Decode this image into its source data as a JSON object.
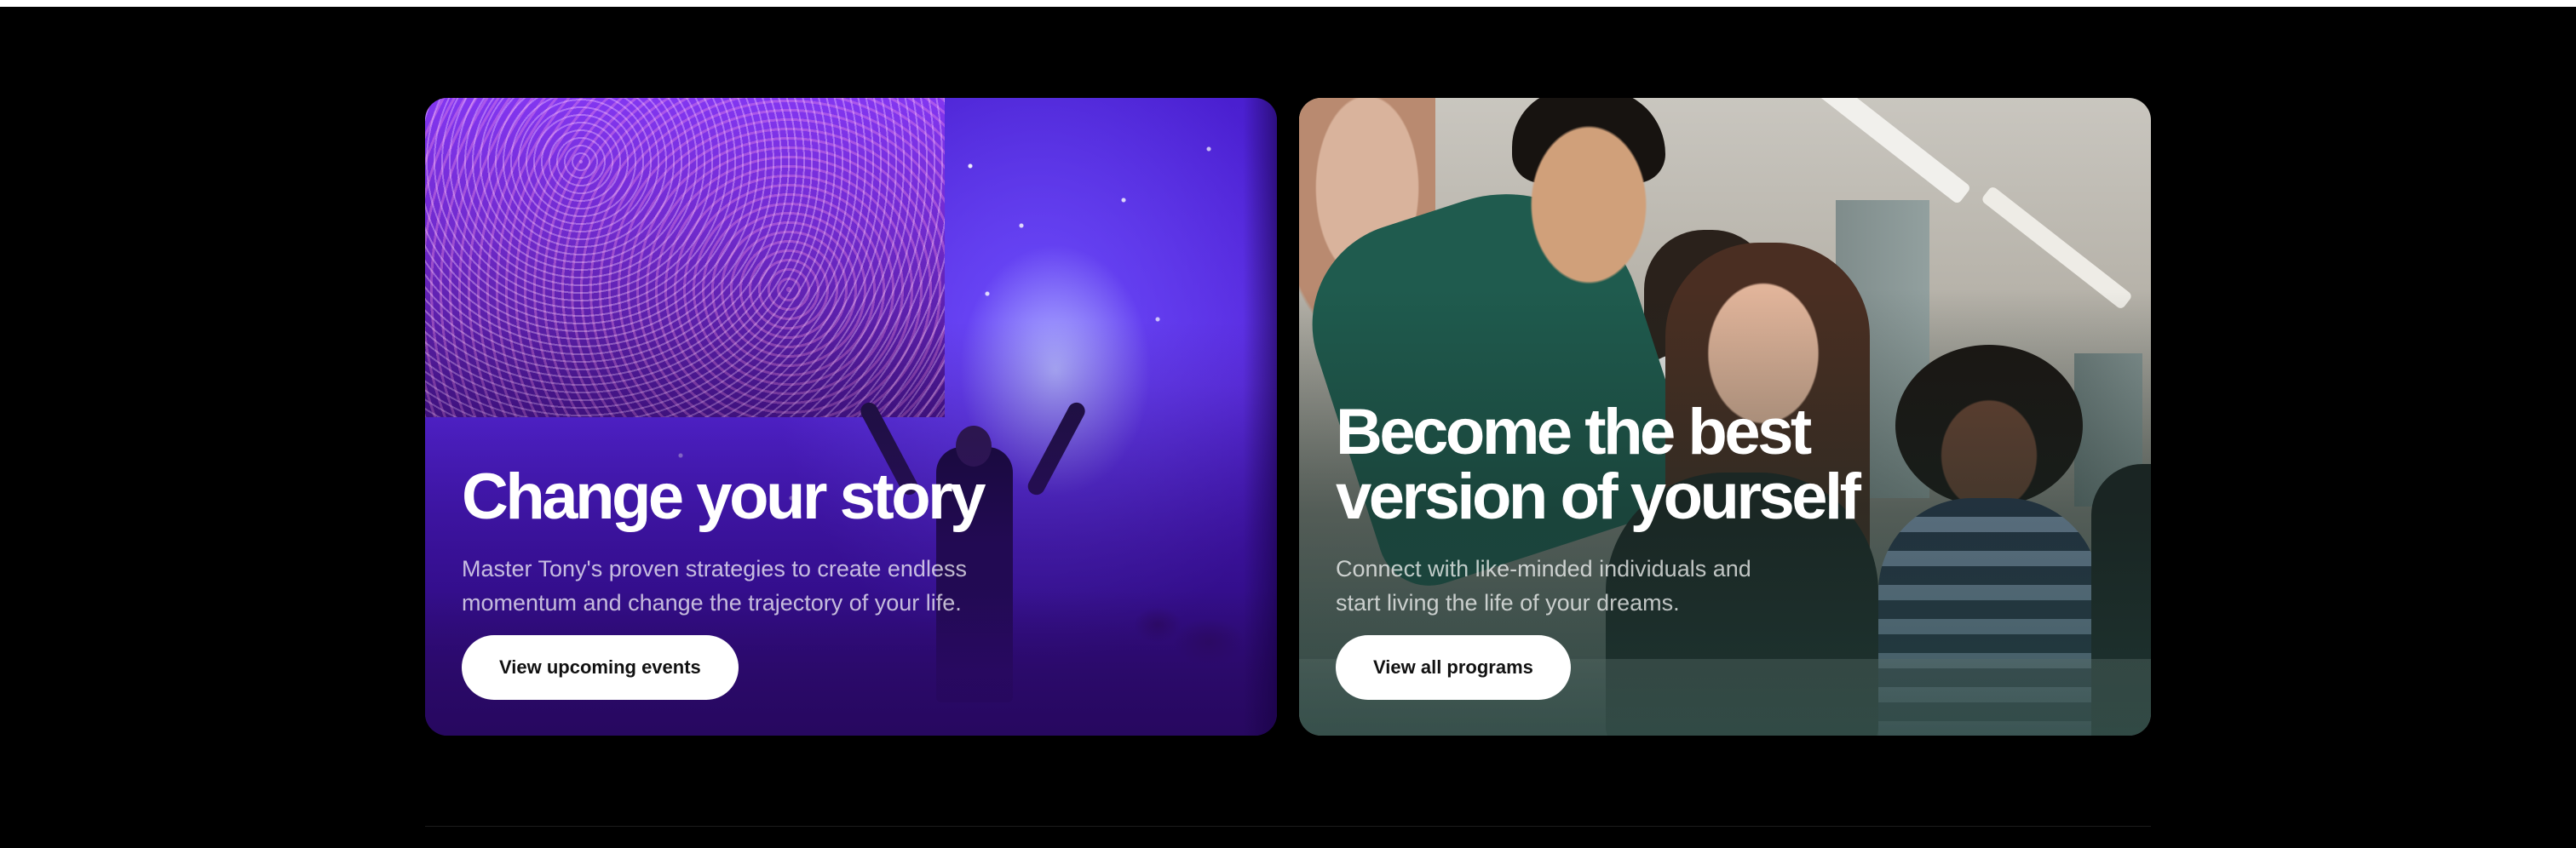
{
  "cards": [
    {
      "title": "Change your story",
      "description": "Master Tony's proven strategies to create endless momentum and change the trajectory of your life.",
      "button_label": "View upcoming events",
      "image": "event-stage-photo"
    },
    {
      "title": "Become the best version of yourself",
      "description": "Connect with like-minded individuals and start living the life of your dreams.",
      "button_label": "View all programs",
      "image": "group-people-photo"
    }
  ],
  "colors": {
    "page_background": "#000000",
    "button_background": "#ffffff",
    "button_text": "#111111",
    "left_card_accent": "#5a2ae0",
    "right_card_accent": "#1f5b4e"
  }
}
